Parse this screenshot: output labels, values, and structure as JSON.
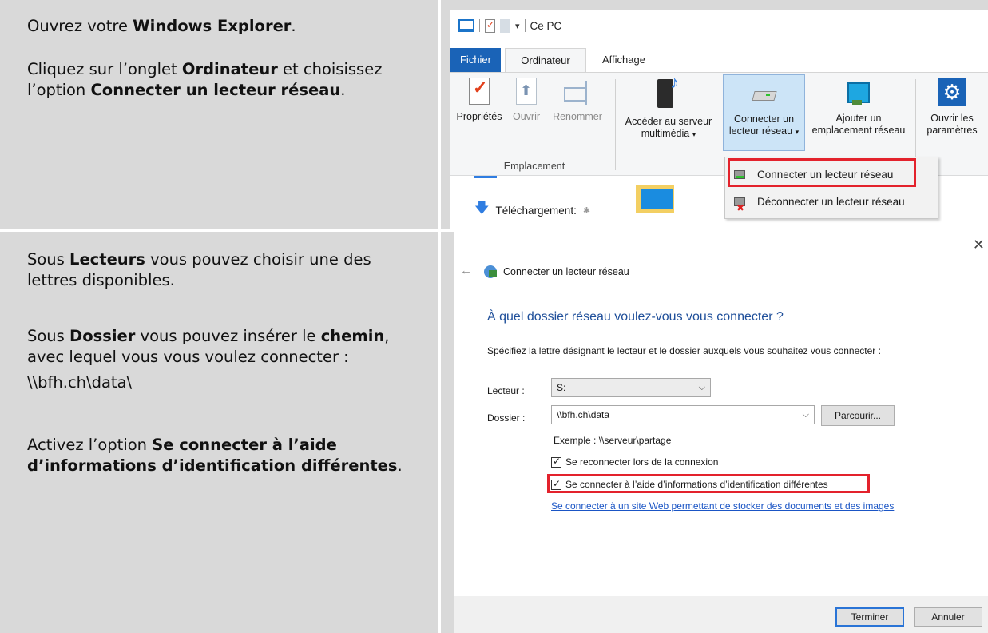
{
  "step1": {
    "line1_pre": "Ouvrez votre ",
    "line1_bold": "Windows Explorer",
    "line1_post": ".",
    "line2_pre": "Cliquez sur l’onglet ",
    "line2_bold1": "Ordinateur",
    "line2_mid": " et choisissez l’option ",
    "line2_bold2": "Connecter un lecteur réseau",
    "line2_post": "."
  },
  "step2": {
    "p1_pre": "Sous ",
    "p1_bold": "Lecteurs",
    "p1_post": " vous pouvez choisir une des lettres disponibles.",
    "p2_pre": "Sous ",
    "p2_bold1": "Dossier",
    "p2_mid": " vous pouvez insérer le ",
    "p2_bold2": "chemin",
    "p2_post": ", avec lequel vous vous voulez connecter :",
    "path": "\\\\bfh.ch\\data\\",
    "p3_pre": "Activez l’option ",
    "p3_bold": "Se connecter à l’aide d’informations d’identification différentes",
    "p3_post": "."
  },
  "explorer": {
    "window_title": "Ce PC",
    "tabs": [
      "Fichier",
      "Ordinateur",
      "Affichage"
    ],
    "ribbon": {
      "properties": "Propriétés",
      "open": "Ouvrir",
      "rename": "Renommer",
      "media_l1": "Accéder au serveur",
      "media_l2": "multimédia",
      "connect_l1": "Connecter un",
      "connect_l2": "lecteur réseau",
      "add_l1": "Ajouter un",
      "add_l2": "emplacement réseau",
      "settings_l1": "Ouvrir les",
      "settings_l2": "paramètres",
      "group_label": "Emplacement"
    },
    "nav_item": "Téléchargement:",
    "dropdown": {
      "connect": "Connecter un lecteur réseau",
      "disconnect": "Déconnecter un lecteur réseau"
    }
  },
  "dialog": {
    "title": "Connecter un lecteur réseau",
    "heading": "À quel dossier réseau voulez-vous vous connecter ?",
    "description": "Spécifiez la lettre désignant le lecteur et le dossier auxquels vous souhaitez vous connecter :",
    "drive_label": "Lecteur :",
    "drive_value": "S:",
    "folder_label": "Dossier :",
    "folder_value": "\\\\bfh.ch\\data",
    "browse_button": "Parcourir...",
    "example": "Exemple : \\\\serveur\\partage",
    "reconnect": "Se reconnecter lors de la connexion",
    "reconnect_checked": true,
    "alt_credentials": "Se connecter à l’aide d’informations d’identification différentes",
    "alt_credentials_checked": true,
    "website_link": "Se connecter à un site Web permettant de stocker des documents et des images",
    "finish_button": "Terminer",
    "cancel_button": "Annuler",
    "colors": {
      "heading": "#1f4f9a",
      "link": "#1a55c5",
      "highlight_box": "#e3222c",
      "fichier_tab": "#1a63b7"
    }
  }
}
